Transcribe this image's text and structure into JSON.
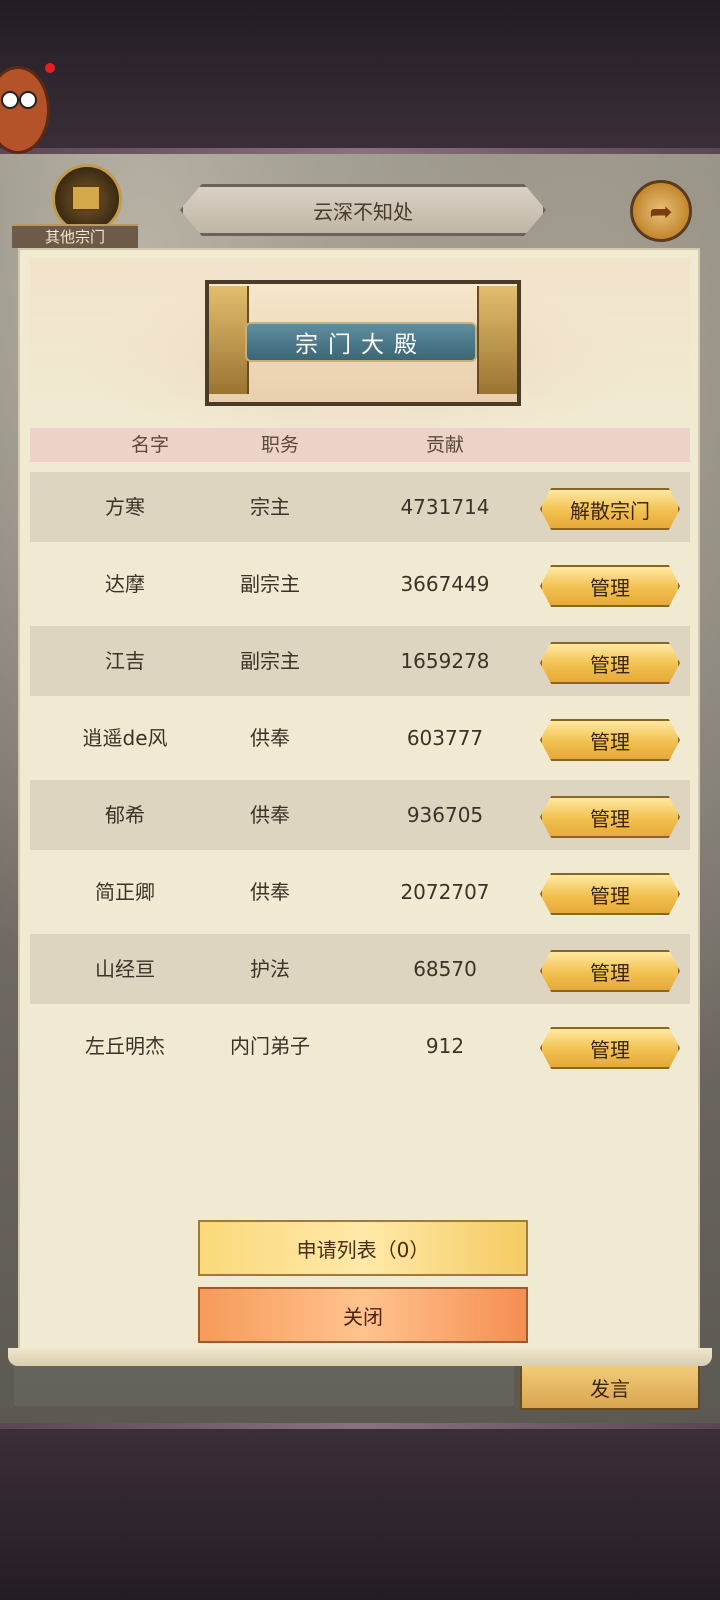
{
  "header": {
    "sect_name": "云深不知处",
    "other_sects_label": "其他宗门"
  },
  "hall": {
    "title": "宗门大殿"
  },
  "columns": [
    "名字",
    "职务",
    "贡献"
  ],
  "members": [
    {
      "name": "方寒",
      "role": "宗主",
      "contribution": "4731714",
      "action": "解散宗门"
    },
    {
      "name": "达摩",
      "role": "副宗主",
      "contribution": "3667449",
      "action": "管理"
    },
    {
      "name": "江吉",
      "role": "副宗主",
      "contribution": "1659278",
      "action": "管理"
    },
    {
      "name": "逍遥de风",
      "role": "供奉",
      "contribution": "603777",
      "action": "管理"
    },
    {
      "name": "郁希",
      "role": "供奉",
      "contribution": "936705",
      "action": "管理"
    },
    {
      "name": "简正卿",
      "role": "供奉",
      "contribution": "2072707",
      "action": "管理"
    },
    {
      "name": "山经亘",
      "role": "护法",
      "contribution": "68570",
      "action": "管理"
    },
    {
      "name": "左丘明杰",
      "role": "内门弟子",
      "contribution": "912",
      "action": "管理"
    }
  ],
  "buttons": {
    "apply_list": "申请列表（0）",
    "close": "关闭",
    "speak": "发言"
  },
  "icons": {
    "back": "back-arrow-icon",
    "other_sects": "sect-emblem-icon",
    "avatar": "mascot-avatar-icon"
  },
  "colors": {
    "panel": "#f1ead2",
    "gold_button": "#f2c04f",
    "close_button": "#f79a5a"
  }
}
